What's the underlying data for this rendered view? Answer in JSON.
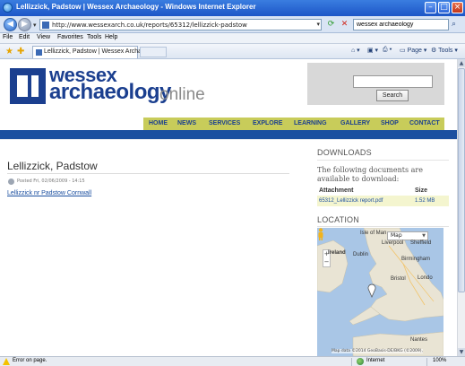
{
  "window": {
    "title": "Lellizzick, Padstow | Wessex Archaeology - Windows Internet Explorer"
  },
  "address_bar": {
    "url": "http://www.wessexarch.co.uk/reports/65312/lellizzick-padstow",
    "search_value": "wessex archaeology"
  },
  "menu": {
    "items": [
      "File",
      "Edit",
      "View",
      "Favorites",
      "Tools",
      "Help"
    ]
  },
  "tab_bar": {
    "tab_title": "Lellizzick, Padstow | Wessex Archaeology",
    "page_label": "Page",
    "tools_label": "Tools"
  },
  "site": {
    "logo_word1": "wessex",
    "logo_word2": "archaeology",
    "logo_word3": "online",
    "search_button": "Search",
    "nav": [
      "HOME",
      "NEWS",
      "SERVICES",
      "EXPLORE",
      "LEARNING",
      "GALLERY",
      "SHOP",
      "CONTACT"
    ]
  },
  "content": {
    "page_title": "Lellizzick, Padstow",
    "posted": "Posted Fri, 02/06/2009 - 14:15",
    "link_text": "Lellizzick nr Padstow Cornwall"
  },
  "downloads": {
    "heading": "DOWNLOADS",
    "intro": "The following documents are available to download:",
    "col_attachment": "Attachment",
    "col_size": "Size",
    "file_name": "65312_Lellizzick report.pdf",
    "file_size": "1.52 MB"
  },
  "location": {
    "heading": "LOCATION",
    "map_type": "Map",
    "labels": {
      "isle_of_man": "Isle of Man",
      "ireland": "Ireland",
      "dublin": "Dublin",
      "liverpool": "Liverpool",
      "sheffield": "Sheffield",
      "birmingham": "Birmingham",
      "bristol": "Bristol",
      "london": "Londo",
      "nantes": "Nantes"
    },
    "attribution": "Map data ©2014 GeoBasis-DE/BKG (©2009),"
  },
  "status": {
    "left_text": "Error on page.",
    "zone": "Internet",
    "zoom": "100%"
  },
  "colors": {
    "brand_blue": "#1b3f8f",
    "nav_green": "#c8cc5a",
    "download_row": "#f4f5cf"
  }
}
